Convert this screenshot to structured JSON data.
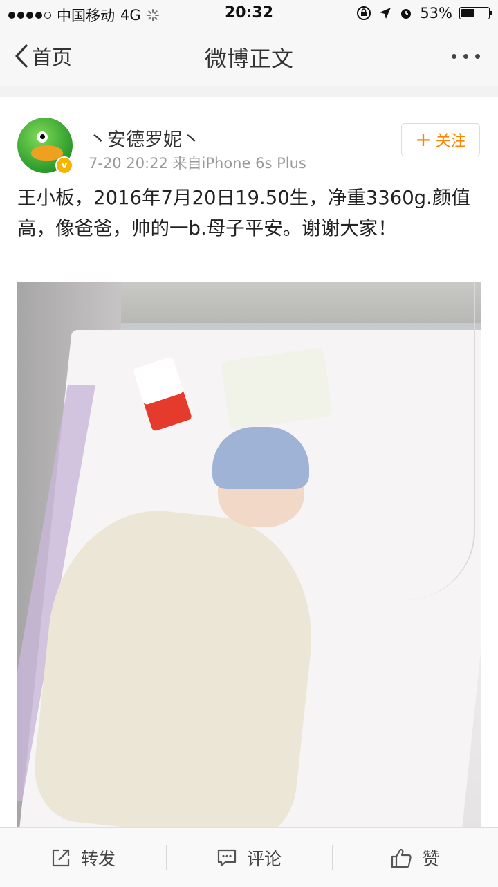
{
  "status_bar": {
    "carrier": "中国移动",
    "network": "4G",
    "time": "20:32",
    "battery_percent": "53%",
    "battery_level": 0.53
  },
  "nav": {
    "back_label": "首页",
    "title": "微博正文"
  },
  "post": {
    "user_name": "丶安德罗妮丶",
    "meta": "7-20 20:22  来自iPhone 6s Plus",
    "follow_label": "关注",
    "follow_plus": "+",
    "verified_badge": "v",
    "text": "王小板，2016年7月20日19.50生，净重3360g.颜值高，像爸爸，帅的一b.母子平安。谢谢大家！"
  },
  "toolbar": {
    "repost_label": "转发",
    "comment_label": "评论",
    "like_label": "赞"
  },
  "colors": {
    "accent": "#ff8200",
    "verified": "#f5b400"
  },
  "icons": [
    "signal-dots-icon",
    "loading-spinner-icon",
    "orientation-lock-icon",
    "location-arrow-icon",
    "alarm-icon",
    "battery-icon",
    "back-chevron-icon",
    "more-dots-icon",
    "repost-icon",
    "comment-icon",
    "like-icon"
  ]
}
